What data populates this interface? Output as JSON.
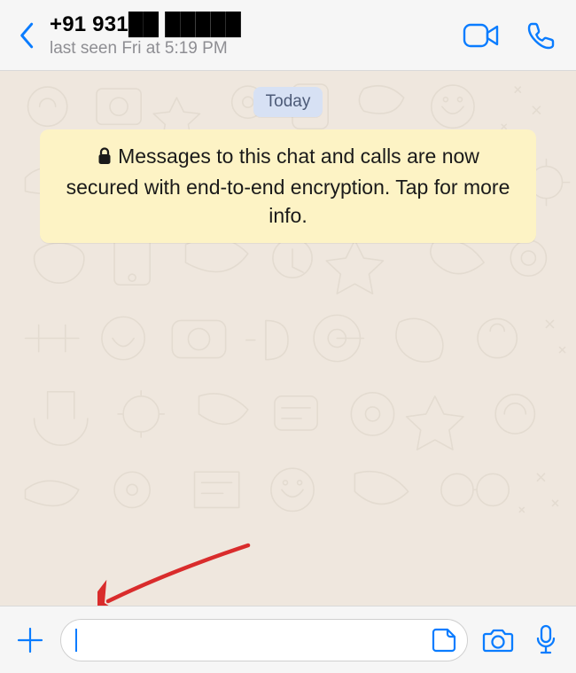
{
  "header": {
    "contact_name": "+91 931██ █████",
    "status": "last seen Fri at 5:19 PM"
  },
  "chat": {
    "date_label": "Today",
    "encryption_notice": "Messages to this chat and calls are now secured with end-to-end encryption. Tap for more info."
  },
  "footer": {
    "input_value": "",
    "input_placeholder": ""
  },
  "colors": {
    "accent": "#0a7cff",
    "header_bg": "#f6f6f6",
    "chat_bg": "#efe7de",
    "date_chip_bg": "#d7e1f4",
    "encryption_bg": "#fdf3c5"
  },
  "icons": {
    "back": "chevron-left",
    "video": "video-camera",
    "call": "phone",
    "plus": "plus",
    "sticker": "sticker",
    "camera": "camera",
    "mic": "microphone",
    "lock": "lock"
  }
}
